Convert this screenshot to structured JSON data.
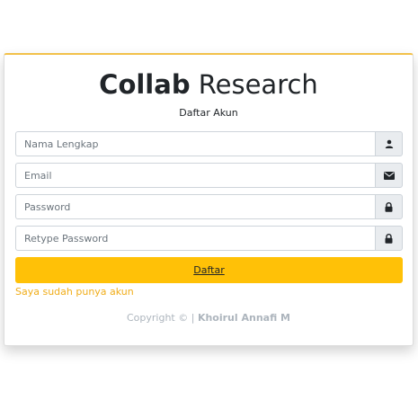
{
  "header": {
    "title_bold": "Collab",
    "title_rest": " Research",
    "subtitle": "Daftar Akun"
  },
  "form": {
    "fields": [
      {
        "placeholder": "Nama Lengkap",
        "type": "text",
        "icon": "user-icon"
      },
      {
        "placeholder": "Email",
        "type": "email",
        "icon": "envelope-icon"
      },
      {
        "placeholder": "Password",
        "type": "password",
        "icon": "lock-icon"
      },
      {
        "placeholder": "Retype Password",
        "type": "password",
        "icon": "lock-icon"
      }
    ],
    "submit_label": "Daftar",
    "login_link": "Saya sudah punya akun"
  },
  "footer": {
    "copyright_prefix": "Copyright © | ",
    "author": "Khoirul Annafi M"
  },
  "colors": {
    "accent": "#ffc107",
    "link": "#f0ad1a",
    "addon_bg": "#e9ecef",
    "muted": "#adb5bd"
  }
}
